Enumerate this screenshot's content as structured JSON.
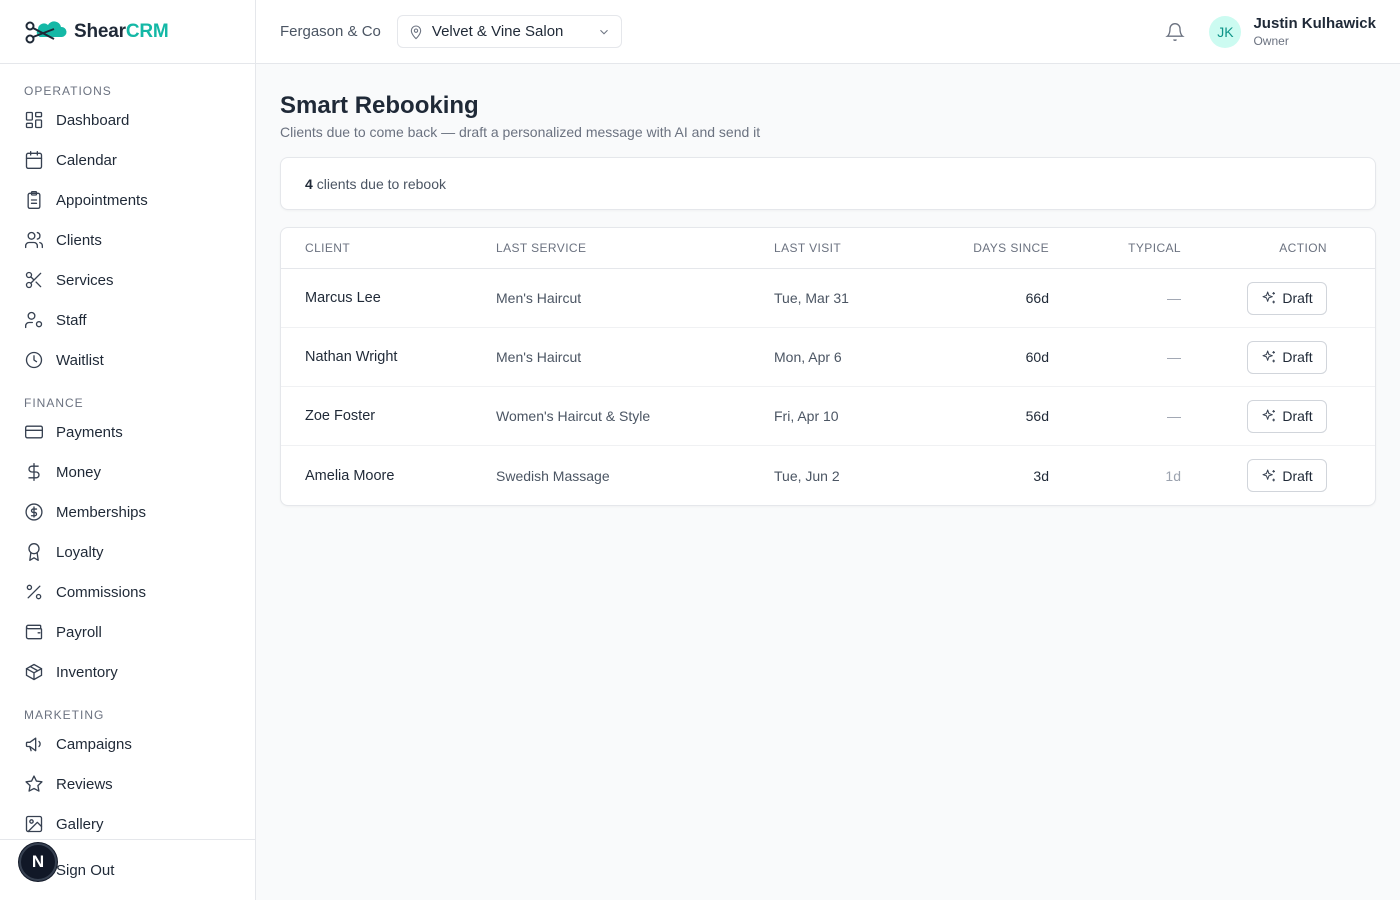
{
  "brand": {
    "name_part1": "Shear",
    "name_part2": "CRM"
  },
  "sidebar": {
    "sections": [
      {
        "title": "OPERATIONS",
        "items": [
          "Dashboard",
          "Calendar",
          "Appointments",
          "Clients",
          "Services",
          "Staff",
          "Waitlist"
        ]
      },
      {
        "title": "FINANCE",
        "items": [
          "Payments",
          "Money",
          "Memberships",
          "Loyalty",
          "Commissions",
          "Payroll",
          "Inventory"
        ]
      },
      {
        "title": "MARKETING",
        "items": [
          "Campaigns",
          "Reviews",
          "Gallery"
        ]
      }
    ],
    "footer": {
      "sign_out": "Sign Out",
      "badge": "N"
    }
  },
  "header": {
    "org": "Fergason & Co",
    "location": "Velvet & Vine Salon",
    "user": {
      "initials": "JK",
      "name": "Justin Kulhawick",
      "role": "Owner"
    }
  },
  "page": {
    "title": "Smart Rebooking",
    "subtitle": "Clients due to come back — draft a personalized message with AI and send it",
    "count": "4",
    "count_label": "clients due to rebook"
  },
  "table": {
    "headers": {
      "client": "CLIENT",
      "service": "LAST SERVICE",
      "visit": "LAST VISIT",
      "days": "DAYS SINCE",
      "typical": "TYPICAL",
      "action": "ACTION"
    },
    "rows": [
      {
        "client": "Marcus Lee",
        "service": "Men's Haircut",
        "visit": "Tue, Mar 31",
        "days": "66d",
        "typical": "—",
        "action": "Draft"
      },
      {
        "client": "Nathan Wright",
        "service": "Men's Haircut",
        "visit": "Mon, Apr 6",
        "days": "60d",
        "typical": "—",
        "action": "Draft"
      },
      {
        "client": "Zoe Foster",
        "service": "Women's Haircut & Style",
        "visit": "Fri, Apr 10",
        "days": "56d",
        "typical": "—",
        "action": "Draft"
      },
      {
        "client": "Amelia Moore",
        "service": "Swedish Massage",
        "visit": "Tue, Jun 2",
        "days": "3d",
        "typical": "1d",
        "action": "Draft"
      }
    ]
  },
  "colors": {
    "accent": "#14b8a6",
    "text": "#1f2937",
    "muted": "#6b7280",
    "border": "#e5e7eb"
  },
  "icons": {
    "Dashboard": "dashboard-icon",
    "Calendar": "calendar-icon",
    "Appointments": "clipboard-icon",
    "Clients": "users-icon",
    "Services": "scissors-icon",
    "Staff": "user-cog-icon",
    "Waitlist": "clock-icon",
    "Payments": "credit-card-icon",
    "Money": "dollar-icon",
    "Memberships": "badge-dollar-icon",
    "Loyalty": "award-icon",
    "Commissions": "percent-icon",
    "Payroll": "wallet-icon",
    "Inventory": "package-icon",
    "Campaigns": "megaphone-icon",
    "Reviews": "star-icon",
    "Gallery": "image-icon"
  }
}
